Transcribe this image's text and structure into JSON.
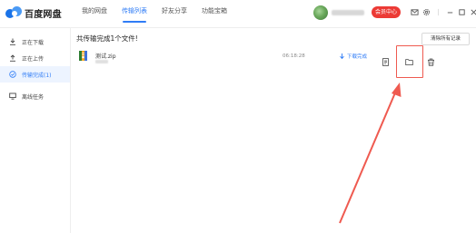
{
  "app": {
    "logo_text": "百度网盘"
  },
  "nav": {
    "items": [
      {
        "label": "我的网盘"
      },
      {
        "label": "传输列表"
      },
      {
        "label": "好友分享"
      },
      {
        "label": "功能宝箱"
      }
    ],
    "active_index": 1
  },
  "header": {
    "member_button": "会员中心",
    "icons": [
      "mail-icon",
      "gear-icon",
      "minimize-icon",
      "maximize-icon",
      "close-icon"
    ]
  },
  "sidebar": {
    "items": [
      {
        "label": "正在下载",
        "icon": "download-icon"
      },
      {
        "label": "正在上传",
        "icon": "upload-icon"
      },
      {
        "label": "传输完成(1)",
        "icon": "check-circle-icon"
      },
      {
        "label": "离线任务",
        "icon": "offline-task-icon"
      }
    ],
    "active_index": 2
  },
  "main": {
    "summary": "共传输完成1个文件!",
    "clear_button": "清除所有记录",
    "files": [
      {
        "name": "测试.zip",
        "time": "06:18:28",
        "status": "下载完成",
        "actions": [
          "open-file-icon",
          "open-folder-icon",
          "delete-icon"
        ]
      }
    ]
  },
  "colors": {
    "accent": "#2f7cf6",
    "member_red": "#ec3a35",
    "annotation_red": "#ef5a50",
    "sidebar_active_bg": "#edf4ff"
  }
}
